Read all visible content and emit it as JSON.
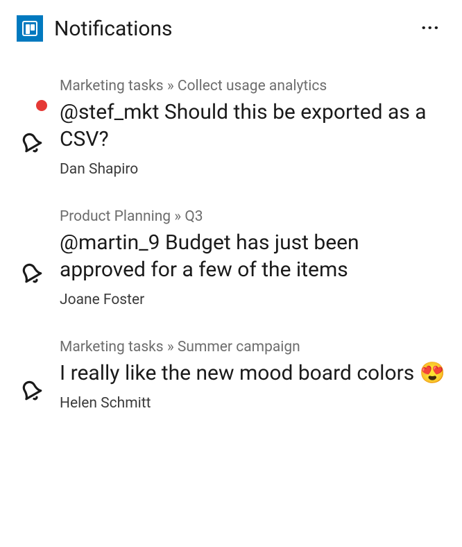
{
  "header": {
    "title": "Notifications",
    "more_label": "···"
  },
  "notifications": [
    {
      "breadcrumb": "Marketing tasks » Collect usage analytics",
      "message": "@stef_mkt Should this be exported as a CSV?",
      "author": "Dan Shapiro",
      "unread": true
    },
    {
      "breadcrumb": "Product Planning » Q3",
      "message": "@martin_9 Budget has just been approved for a few of the items",
      "author": "Joane Foster",
      "unread": false
    },
    {
      "breadcrumb": "Marketing tasks » Summer campaign",
      "message": "I really like the new mood board colors 😍",
      "author": "Helen Schmitt",
      "unread": false
    }
  ]
}
